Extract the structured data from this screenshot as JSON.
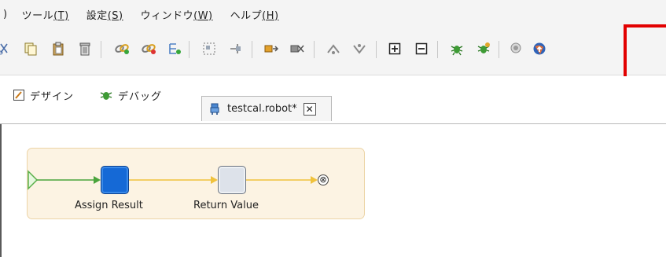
{
  "menubar": {
    "partial_left": ")",
    "items": [
      {
        "label": "ツール",
        "mnemonic": "(T)"
      },
      {
        "label": "設定",
        "mnemonic": "(S)"
      },
      {
        "label": "ウィンドウ",
        "mnemonic": "(W)"
      },
      {
        "label": "ヘルプ",
        "mnemonic": "(H)"
      }
    ]
  },
  "toolbar": {
    "icons": [
      "cut-icon",
      "copy-icon",
      "paste-icon",
      "delete-icon",
      "link-icon",
      "unlink-icon",
      "branch-icon",
      "group-icon",
      "ungroup-icon",
      "step-in-icon",
      "step-over-icon",
      "move-up-icon",
      "move-down-icon",
      "expand-icon",
      "collapse-icon",
      "debug-icon",
      "debug-all-icon",
      "search-icon",
      "deploy-icon"
    ],
    "colors": {
      "highlight": "#e20000"
    }
  },
  "perspectives": {
    "design": {
      "label": "デザイン"
    },
    "debug": {
      "label": "デバッグ"
    }
  },
  "editor": {
    "tab_title": "testcal.robot*",
    "close_glyph": "✕"
  },
  "flow": {
    "nodes": [
      {
        "label": "Assign Result",
        "color": "#1569d6"
      },
      {
        "label": "Return Value",
        "color": "#dde2ea"
      }
    ],
    "end_glyph": "⊗"
  }
}
